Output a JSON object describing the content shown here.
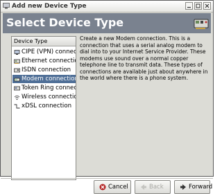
{
  "window": {
    "title": "Add new Device Type"
  },
  "banner": {
    "title": "Select Device Type"
  },
  "list": {
    "header": "Device Type",
    "items": [
      {
        "label": "CIPE (VPN) connecti",
        "icon": "vpn-icon",
        "selected": false
      },
      {
        "label": "Ethernet connection",
        "icon": "ethernet-icon",
        "selected": false
      },
      {
        "label": "ISDN connection",
        "icon": "isdn-icon",
        "selected": false
      },
      {
        "label": "Modem connection",
        "icon": "modem-icon",
        "selected": true
      },
      {
        "label": "Token Ring connectio",
        "icon": "token-ring-icon",
        "selected": false
      },
      {
        "label": "Wireless connection",
        "icon": "wireless-icon",
        "selected": false
      },
      {
        "label": "xDSL connection",
        "icon": "xdsl-icon",
        "selected": false
      }
    ]
  },
  "description": "Create a new Modem connection.  This is a\nconnection that uses a serial analog modem to\ndial into to your Internet Service Provider. These\nmodems use sound over a normal copper\ntelephone line to transmit data.  These types of\nconnections are available just about anywhere in\nthe world where there is a phone system.",
  "buttons": {
    "cancel": "Cancel",
    "back": "Back",
    "forward": "Forward"
  },
  "colors": {
    "banner": "#7a828f",
    "selection": "#4f6f97",
    "window_bg": "#dcdcd6"
  }
}
